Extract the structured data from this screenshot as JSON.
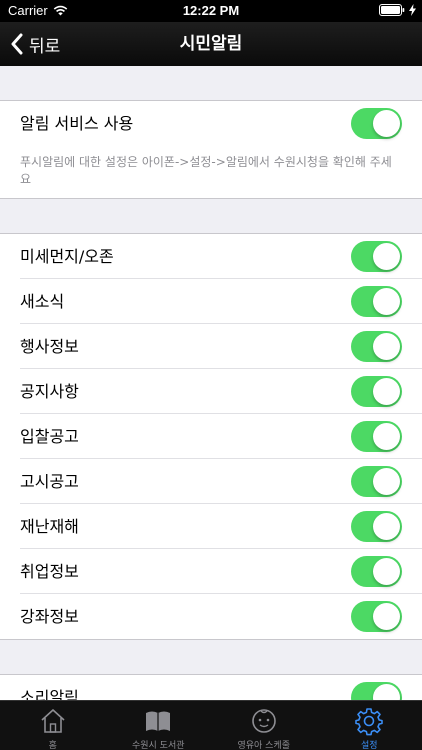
{
  "status_bar": {
    "carrier": "Carrier",
    "time": "12:22 PM"
  },
  "nav": {
    "back_label": "뒤로",
    "title": "시민알림"
  },
  "section1": {
    "label": "알림 서비스 사용",
    "enabled": true,
    "note": "푸시알림에 대한 설정은 아이폰->설정->알림에서 수원시청을 확인해 주세요"
  },
  "categories": [
    {
      "label": "미세먼지/오존",
      "enabled": true
    },
    {
      "label": "새소식",
      "enabled": true
    },
    {
      "label": "행사정보",
      "enabled": true
    },
    {
      "label": "공지사항",
      "enabled": true
    },
    {
      "label": "입찰공고",
      "enabled": true
    },
    {
      "label": "고시공고",
      "enabled": true
    },
    {
      "label": "재난재해",
      "enabled": true
    },
    {
      "label": "취업정보",
      "enabled": true
    },
    {
      "label": "강좌정보",
      "enabled": true
    }
  ],
  "section3": {
    "label": "소리알림",
    "enabled": true
  },
  "tabs": [
    {
      "label": "홈",
      "icon": "home-icon"
    },
    {
      "label": "수원시 도서관",
      "icon": "book-icon"
    },
    {
      "label": "영유아 스케줄",
      "icon": "baby-icon"
    },
    {
      "label": "설정",
      "icon": "gear-icon",
      "active": true
    }
  ],
  "colors": {
    "toggle_on": "#4cd964",
    "tab_active": "#3b8ef5",
    "background": "#efeff4"
  }
}
